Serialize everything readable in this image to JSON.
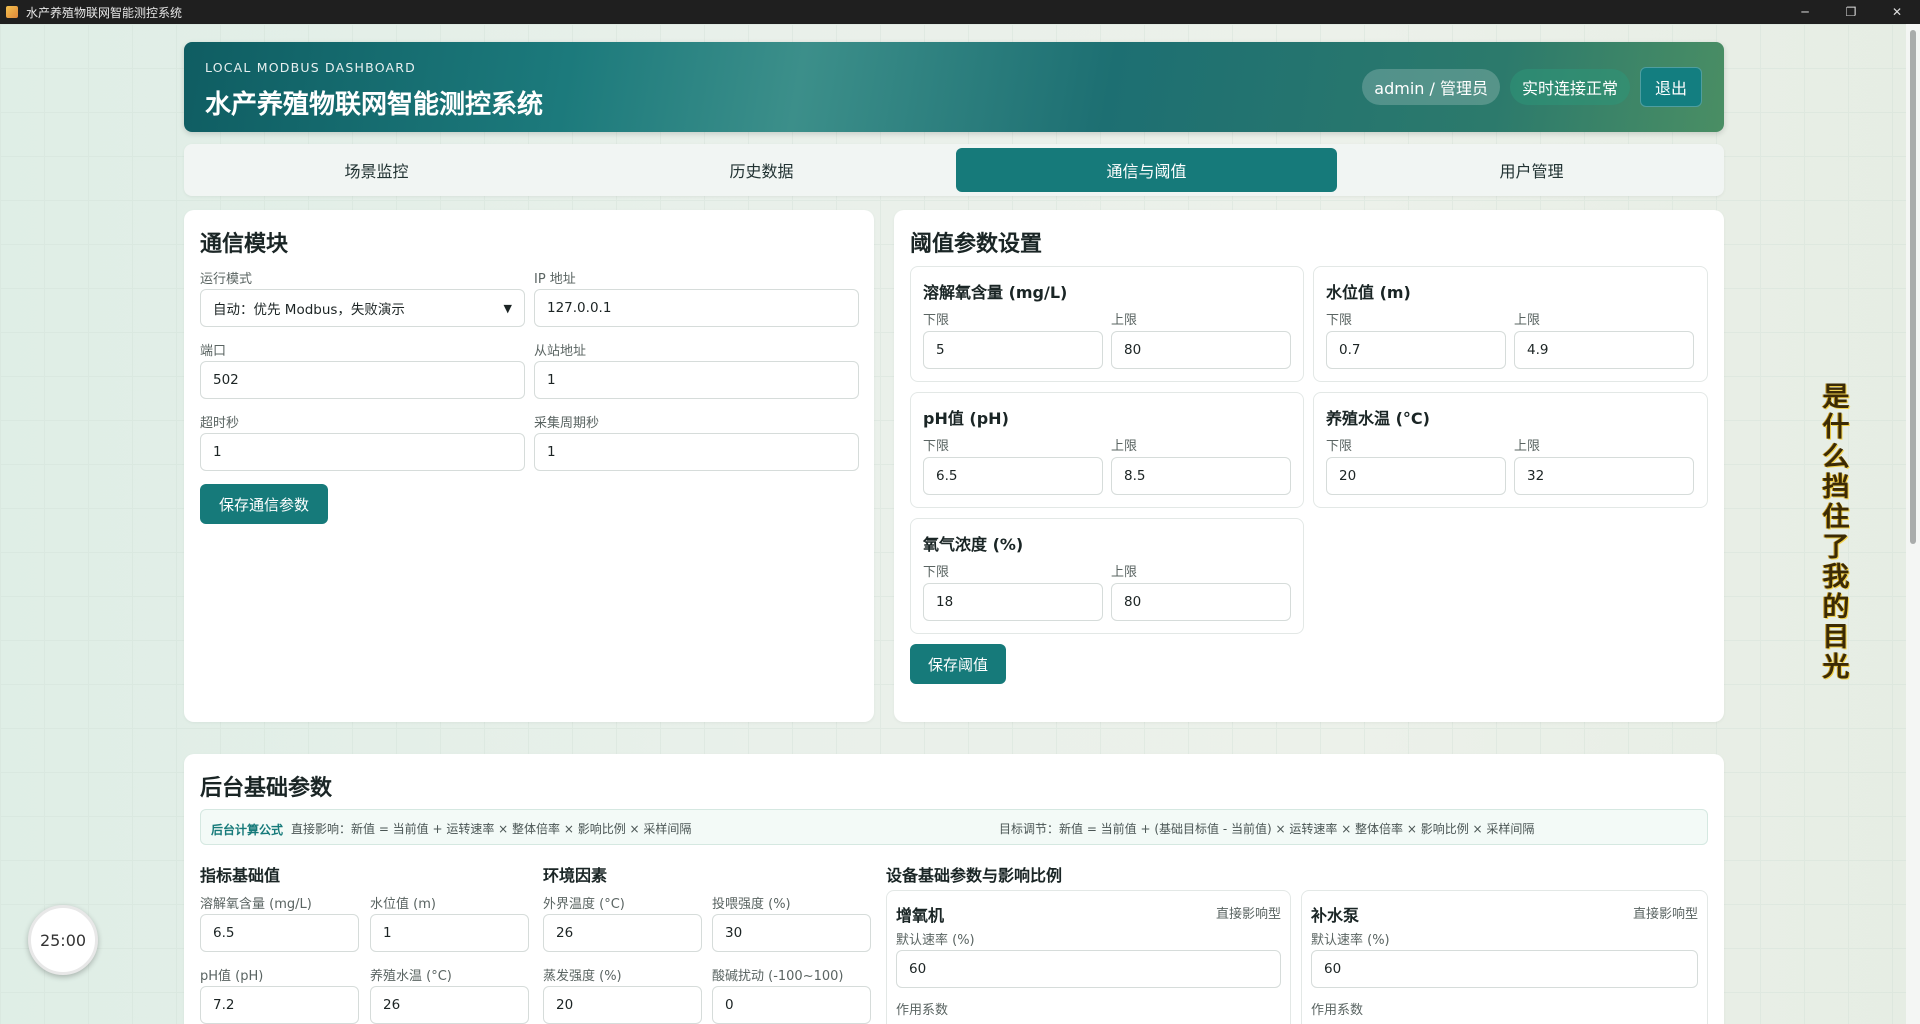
{
  "window": {
    "title": "水产养殖物联网智能测控系统",
    "controls": [
      "─",
      "❐",
      "✕"
    ]
  },
  "header": {
    "subtitle": "LOCAL MODBUS DASHBOARD",
    "title": "水产养殖物联网智能测控系统",
    "user": "admin / 管理员",
    "status": "实时连接正常",
    "logout": "退出"
  },
  "tabs": [
    "场景监控",
    "历史数据",
    "通信与阈值",
    "用户管理"
  ],
  "active_tab": "通信与阈值",
  "comm": {
    "title": "通信模块",
    "mode_label": "运行模式",
    "mode_value": "自动：优先 Modbus，失败演示",
    "ip_label": "IP 地址",
    "ip_value": "127.0.0.1",
    "port_label": "端口",
    "port_value": "502",
    "slave_label": "从站地址",
    "slave_value": "1",
    "timeout_label": "超时秒",
    "timeout_value": "1",
    "period_label": "采集周期秒",
    "period_value": "1",
    "save": "保存通信参数"
  },
  "threshold": {
    "title": "阈值参数设置",
    "low": "下限",
    "high": "上限",
    "save": "保存阈值",
    "items": [
      {
        "name": "溶解氧含量 (mg/L)",
        "low": "5",
        "high": "80"
      },
      {
        "name": "水位值 (m)",
        "low": "0.7",
        "high": "4.9"
      },
      {
        "name": "pH值 (pH)",
        "low": "6.5",
        "high": "8.5"
      },
      {
        "name": "养殖水温 (°C)",
        "low": "20",
        "high": "32"
      },
      {
        "name": "氧气浓度 (%)",
        "low": "18",
        "high": "80"
      }
    ]
  },
  "backend": {
    "title": "后台基础参数",
    "formula_title": "后台计算公式",
    "formula_direct": "直接影响：新值 = 当前值 + 运转速率 × 整体倍率 × 影响比例 × 采样间隔",
    "formula_target": "目标调节：新值 = 当前值 + (基础目标值 - 当前值) × 运转速率 × 整体倍率 × 影响比例 × 采样间隔",
    "base_title": "指标基础值",
    "env_title": "环境因素",
    "device_title": "设备基础参数与影响比例",
    "base": [
      {
        "label": "溶解氧含量 (mg/L)",
        "value": "6.5"
      },
      {
        "label": "水位值 (m)",
        "value": "1"
      },
      {
        "label": "pH值 (pH)",
        "value": "7.2"
      },
      {
        "label": "养殖水温 (°C)",
        "value": "26"
      }
    ],
    "env": [
      {
        "label": "外界温度 (°C)",
        "value": "26"
      },
      {
        "label": "投喂强度 (%)",
        "value": "30"
      },
      {
        "label": "蒸发强度 (%)",
        "value": "20"
      },
      {
        "label": "酸碱扰动 (-100~100)",
        "value": "0"
      }
    ],
    "devices": [
      {
        "name": "增氧机",
        "type": "直接影响型",
        "rate_label": "默认速率 (%)",
        "rate": "60",
        "coef_label": "作用系数"
      },
      {
        "name": "补水泵",
        "type": "直接影响型",
        "rate_label": "默认速率 (%)",
        "rate": "60",
        "coef_label": "作用系数"
      }
    ]
  },
  "timer": "25:00",
  "overlay_text": [
    "是",
    "什",
    "么",
    "挡",
    "住",
    "了",
    "我",
    "的",
    "目",
    "光"
  ]
}
